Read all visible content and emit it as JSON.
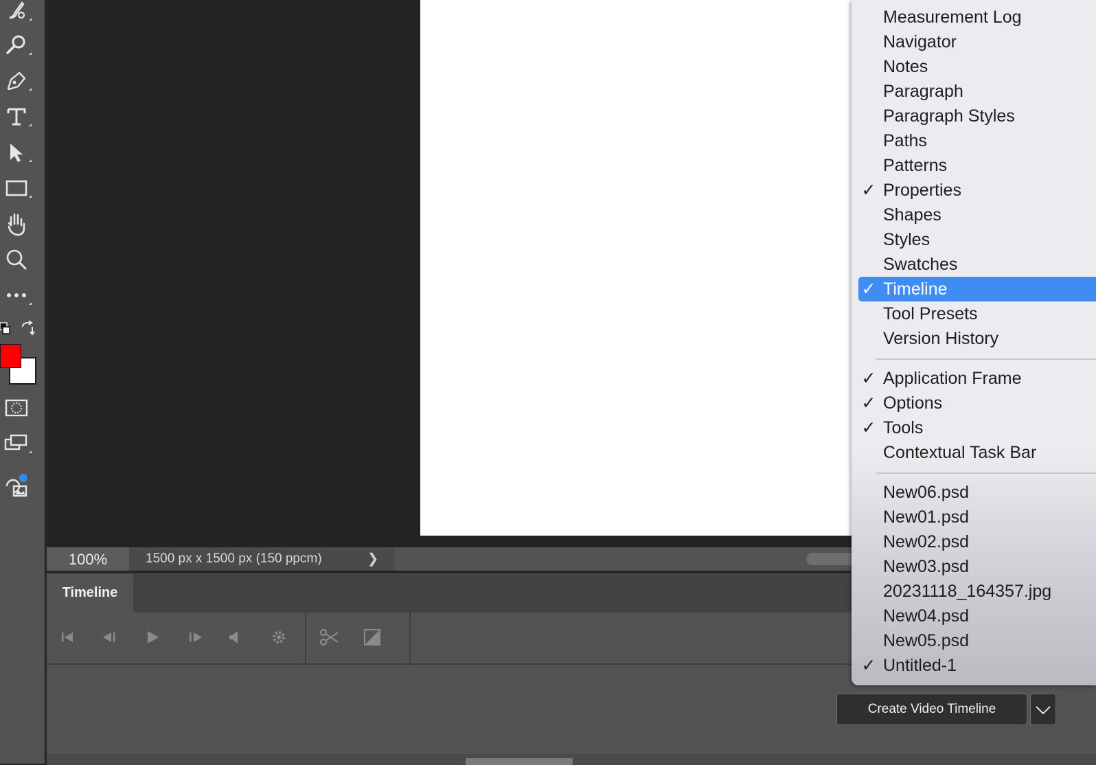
{
  "status": {
    "zoom": "100%",
    "doc_size": "1500 px x 1500 px (150 ppcm)",
    "arrow": "❯"
  },
  "colors": {
    "foreground": "#ff0000",
    "background": "#ffffff",
    "menu_highlight": "#3f8cf3"
  },
  "timeline": {
    "tab_label": "Timeline",
    "create_button_label": "Create Video Timeline"
  },
  "window_menu": {
    "panels": [
      {
        "label": "Measurement Log",
        "checked": false
      },
      {
        "label": "Navigator",
        "checked": false
      },
      {
        "label": "Notes",
        "checked": false
      },
      {
        "label": "Paragraph",
        "checked": false
      },
      {
        "label": "Paragraph Styles",
        "checked": false
      },
      {
        "label": "Paths",
        "checked": false
      },
      {
        "label": "Patterns",
        "checked": false
      },
      {
        "label": "Properties",
        "checked": true
      },
      {
        "label": "Shapes",
        "checked": false
      },
      {
        "label": "Styles",
        "checked": false
      },
      {
        "label": "Swatches",
        "checked": false
      },
      {
        "label": "Timeline",
        "checked": true,
        "highlighted": true
      },
      {
        "label": "Tool Presets",
        "checked": false
      },
      {
        "label": "Version History",
        "checked": false
      }
    ],
    "workspace": [
      {
        "label": "Application Frame",
        "checked": true
      },
      {
        "label": "Options",
        "checked": true
      },
      {
        "label": "Tools",
        "checked": true
      },
      {
        "label": "Contextual Task Bar",
        "checked": false
      }
    ],
    "documents": [
      {
        "label": "New06.psd",
        "checked": false
      },
      {
        "label": "New01.psd",
        "checked": false
      },
      {
        "label": "New02.psd",
        "checked": false
      },
      {
        "label": "New03.psd",
        "checked": false
      },
      {
        "label": "20231118_164357.jpg",
        "checked": false
      },
      {
        "label": "New04.psd",
        "checked": false
      },
      {
        "label": "New05.psd",
        "checked": false
      },
      {
        "label": "Untitled-1",
        "checked": true
      }
    ],
    "check_glyph": "✓"
  }
}
